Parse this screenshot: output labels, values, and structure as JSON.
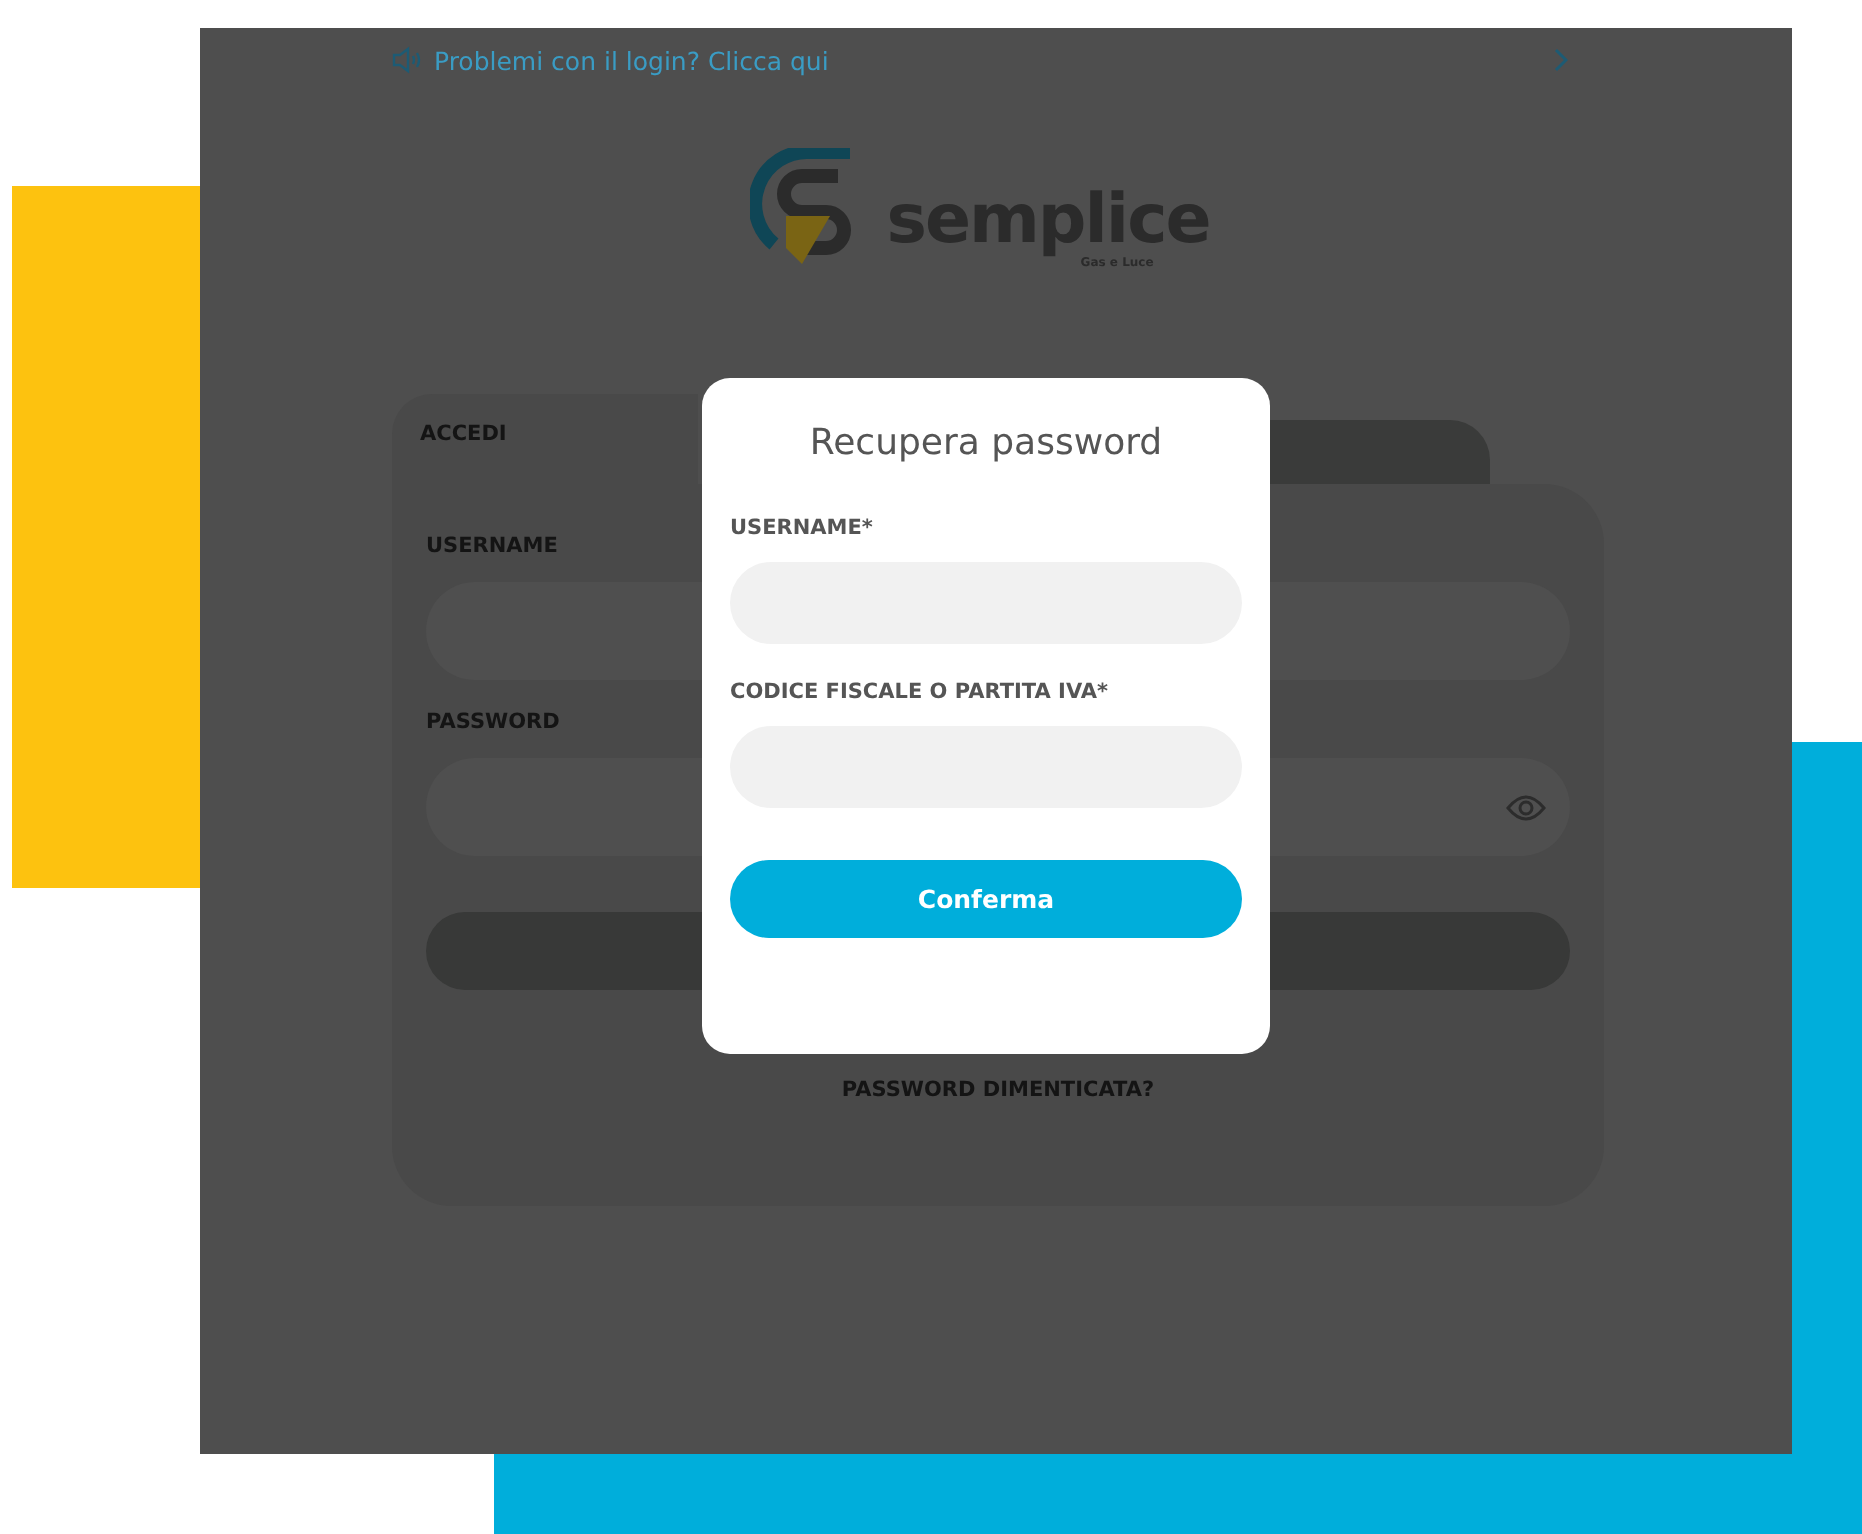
{
  "banner": {
    "text": "Problemi con il login? Clicca qui"
  },
  "logo": {
    "name": "semplice",
    "tagline": "Gas e Luce"
  },
  "login": {
    "tabs": [
      {
        "label": "ACCEDI",
        "selected": true
      },
      {
        "selected": false
      }
    ],
    "fields": [
      {
        "label": "USERNAME",
        "kind": "text"
      },
      {
        "label": "PASSWORD",
        "kind": "password"
      }
    ],
    "forgot_link": "PASSWORD DIMENTICATA?"
  },
  "modal": {
    "title": "Recupera password",
    "fields": [
      {
        "label": "USERNAME*"
      },
      {
        "label": "CODICE FISCALE O PARTITA IVA*"
      }
    ],
    "button": "Conferma"
  }
}
